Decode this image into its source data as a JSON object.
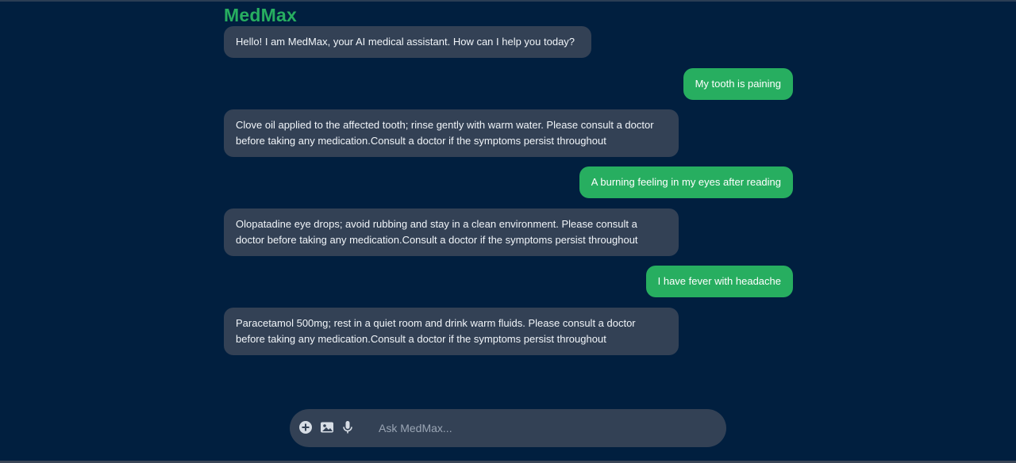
{
  "app": {
    "title": "MedMax"
  },
  "messages": [
    {
      "role": "bot",
      "text": "Hello! I am MedMax, your AI medical assistant. How can I help you today?"
    },
    {
      "role": "user",
      "text": "My tooth is paining"
    },
    {
      "role": "bot",
      "text": "Clove oil applied to the affected tooth; rinse gently with warm water. Please consult a doctor before taking any medication.Consult a doctor if the symptoms persist throughout"
    },
    {
      "role": "user",
      "text": "A burning feeling in my eyes after reading"
    },
    {
      "role": "bot",
      "text": "Olopatadine eye drops; avoid rubbing and stay in a clean environment. Please consult a doctor before taking any medication.Consult a doctor if the symptoms persist throughout"
    },
    {
      "role": "user",
      "text": "I have fever with headache"
    },
    {
      "role": "bot",
      "text": "Paracetamol 500mg; rest in a quiet room and drink warm fluids. Please consult a doctor before taking any medication.Consult a doctor if the symptoms persist throughout"
    }
  ],
  "composer": {
    "placeholder": "Ask MedMax...",
    "value": "",
    "icons": [
      "plus-circle-icon",
      "image-icon",
      "microphone-icon"
    ]
  },
  "colors": {
    "background": "#011f3f",
    "accent": "#27ae60",
    "bot_bubble": "#334155",
    "composer": "#334155"
  }
}
